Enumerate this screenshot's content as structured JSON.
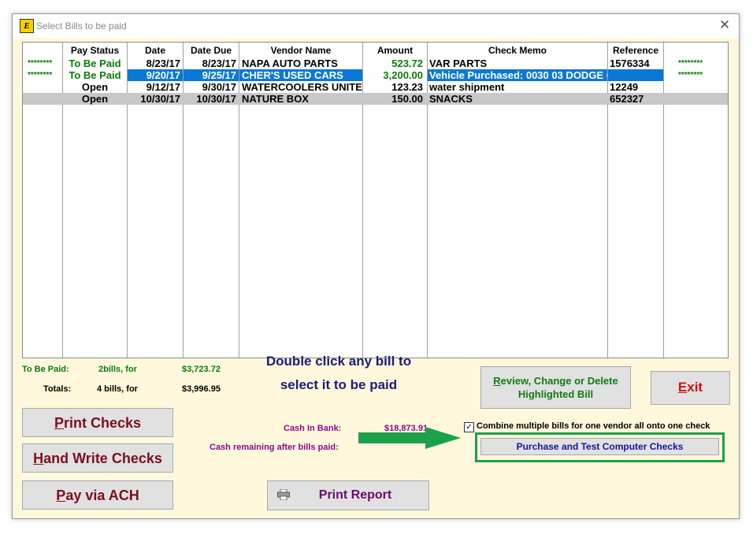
{
  "window": {
    "title": "Select Bills to be paid",
    "app_icon_letter": "E"
  },
  "table": {
    "headers": {
      "pay_status": "Pay Status",
      "date": "Date",
      "date_due": "Date Due",
      "vendor": "Vendor Name",
      "amount": "Amount",
      "memo": "Check Memo",
      "reference": "Reference"
    },
    "rows": [
      {
        "marker_left": "********",
        "pay_status": "To Be Paid",
        "date": "8/23/17",
        "date_due": "8/23/17",
        "vendor": "NAPA AUTO PARTS",
        "amount": "523.72",
        "memo": "VAR PARTS",
        "reference": "1576334",
        "marker_right": "********"
      },
      {
        "marker_left": "********",
        "pay_status": "To Be Paid",
        "date": "9/20/17",
        "date_due": "9/25/17",
        "vendor": "CHER'S USED CARS",
        "amount": "3,200.00",
        "memo": "Vehicle Purchased: 0030 03 DODGE C",
        "reference": "",
        "marker_right": "********"
      },
      {
        "marker_left": "",
        "pay_status": "Open",
        "date": "9/12/17",
        "date_due": "9/30/17",
        "vendor": "WATERCOOLERS UNITED",
        "amount": "123.23",
        "memo": "water shipment",
        "reference": "12249",
        "marker_right": ""
      },
      {
        "marker_left": "",
        "pay_status": "Open",
        "date": "10/30/17",
        "date_due": "10/30/17",
        "vendor": "NATURE BOX",
        "amount": "150.00",
        "memo": "SNACKS",
        "reference": "652327",
        "marker_right": ""
      }
    ]
  },
  "summary": {
    "to_be_paid_label": "To Be Paid:",
    "to_be_paid_count": "2bills, for",
    "to_be_paid_amount": "$3,723.72",
    "totals_label": "Totals:",
    "totals_count": "4 bills, for",
    "totals_amount": "$3,996.95"
  },
  "instruction": {
    "line1": "Double click any bill to",
    "line2": "select it to be paid"
  },
  "buttons": {
    "review_line1": "Review, Change or Delete",
    "review_line2": "Highlighted Bill",
    "review_first_letter": "R",
    "review_rest": "eview, Change or Delete",
    "exit_first": "E",
    "exit_rest": "xit",
    "print_checks_first": "P",
    "print_checks_rest": "rint Checks",
    "hand_write_first": "H",
    "hand_write_rest": "and Write Checks",
    "pay_ach_first": "P",
    "pay_ach_rest": "ay via ACH",
    "print_report": "Print Report",
    "purchase": "Purchase and Test Computer Checks"
  },
  "bank": {
    "cash_label": "Cash In Bank:",
    "cash_value": "$18,873.91",
    "remaining_label": "Cash remaining after bills paid:"
  },
  "combine": {
    "checked": true,
    "label": "Combine multiple bills for one vendor all onto one check"
  },
  "colors": {
    "accent_green": "#1ca14a",
    "selection_blue": "#0a78d7",
    "text_green": "#0a7a0a",
    "button_red": "#7a1020"
  },
  "icons": {
    "printer": "printer-icon",
    "close": "close-icon",
    "arrow": "right-arrow-icon"
  }
}
